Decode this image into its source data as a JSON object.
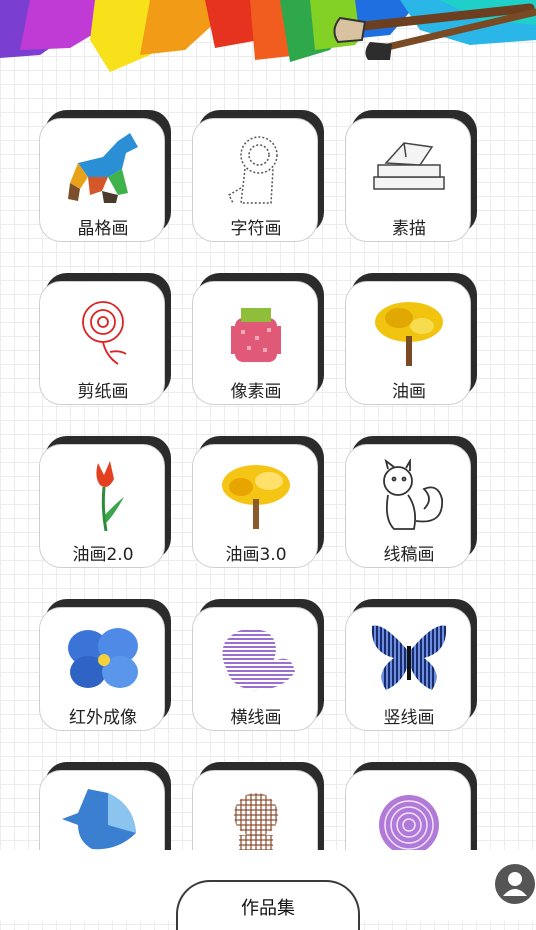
{
  "colors": {
    "card_shadow": "#2b2b2b",
    "tab_border": "#3a3a3a",
    "profile_bg": "#555555"
  },
  "banner": {
    "icon": "paint-brushes-icon"
  },
  "cards": [
    {
      "label": "晶格画",
      "icon": "polygon-horse-icon"
    },
    {
      "label": "字符画",
      "icon": "ascii-lion-icon"
    },
    {
      "label": "素描",
      "icon": "sketch-books-icon"
    },
    {
      "label": "剪纸画",
      "icon": "paper-cut-flower-icon"
    },
    {
      "label": "像素画",
      "icon": "pixel-strawberry-icon"
    },
    {
      "label": "油画",
      "icon": "oil-tree-icon"
    },
    {
      "label": "油画2.0",
      "icon": "tulip-icon"
    },
    {
      "label": "油画3.0",
      "icon": "golden-tree-icon"
    },
    {
      "label": "线稿画",
      "icon": "line-squirrel-icon"
    },
    {
      "label": "红外成像",
      "icon": "blue-flower-icon"
    },
    {
      "label": "横线画",
      "icon": "striped-bird-icon"
    },
    {
      "label": "竖线画",
      "icon": "striped-butterfly-icon"
    },
    {
      "label": "",
      "icon": "dotted-fish-icon"
    },
    {
      "label": "",
      "icon": "grid-figure-icon"
    },
    {
      "label": "",
      "icon": "spiral-circle-icon"
    }
  ],
  "bottom": {
    "works_label": "作品集",
    "profile_icon": "user-icon"
  }
}
